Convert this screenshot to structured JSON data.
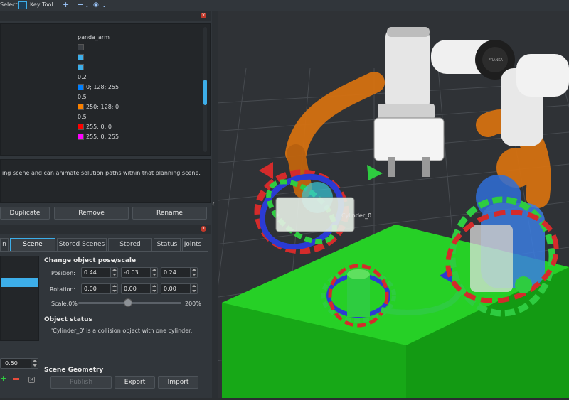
{
  "toolbar": {
    "select_label": "Select",
    "key_tool_label": "Key Tool",
    "plus_glyph": "+",
    "minus_glyph": "−",
    "eye_glyph": "◉",
    "chevron": "⌄"
  },
  "displays": {
    "group_name": "panda_arm",
    "values": [
      {
        "text": "",
        "swatch": "#3b3f44"
      },
      {
        "text": "",
        "swatch": "#3daee9"
      },
      {
        "text": "",
        "swatch": "#3daee9"
      },
      {
        "text": "0.2",
        "swatch": null
      },
      {
        "text": "0; 128; 255",
        "swatch": "#0080ff"
      },
      {
        "text": "0.5",
        "swatch": null
      },
      {
        "text": "250; 128; 0",
        "swatch": "#fa8000"
      },
      {
        "text": "0.5",
        "swatch": null
      },
      {
        "text": "255; 0; 0",
        "swatch": "#ff0000"
      },
      {
        "text": "255; 0; 255",
        "swatch": "#ff00ff"
      }
    ]
  },
  "description": "ing scene and can animate solution paths within that planning scene.",
  "display_buttons": {
    "duplicate": "Duplicate",
    "remove": "Remove",
    "rename": "Rename"
  },
  "tabs": [
    {
      "label": "n",
      "active": false
    },
    {
      "label": "Scene Objects",
      "active": true
    },
    {
      "label": "Stored Scenes",
      "active": false
    },
    {
      "label": "Stored States",
      "active": false
    },
    {
      "label": "Status",
      "active": false
    },
    {
      "label": "Joints",
      "active": false
    }
  ],
  "scene_objects": {
    "pose_title": "Change object pose/scale",
    "position_label": "Position:",
    "position": [
      "0.44",
      "-0.03",
      "0.24"
    ],
    "rotation_label": "Rotation:",
    "rotation": [
      "0.00",
      "0.00",
      "0.00"
    ],
    "scale_label": "Scale:0%",
    "scale_max": "200%",
    "scale_value": 0.48,
    "status_title": "Object status",
    "status_text": "'Cylinder_0' is a collision object with one cylinder.",
    "size_value": "0.50",
    "geometry_title": "Scene Geometry",
    "publish_label": "Publish",
    "export_label": "Export",
    "import_label": "Import"
  },
  "viewport": {
    "object_label": "Cylinder_0",
    "robot_brand": "FRANKA"
  },
  "colors": {
    "accent": "#3daee9",
    "table_green": "#1fbf1f",
    "arm_orange": "#d9720f",
    "goal_blue": "#2f6fd8"
  }
}
